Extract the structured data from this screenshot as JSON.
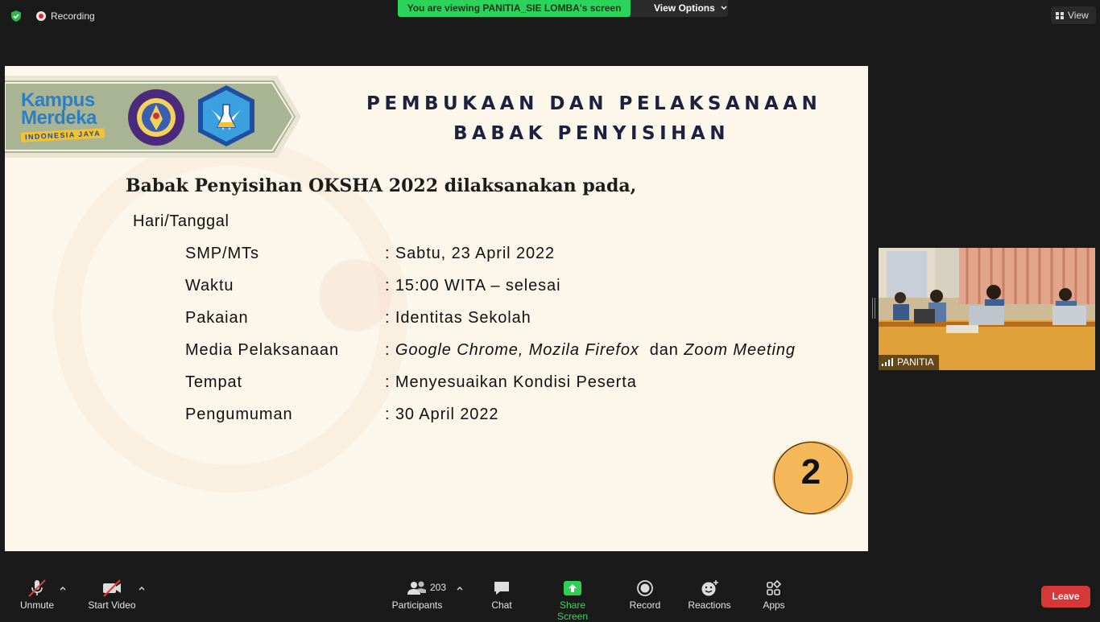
{
  "top_bar": {
    "recording_label": "Recording",
    "viewing_text": "You are viewing PANITIA_SIE LOMBA's screen",
    "view_options_label": "View Options",
    "view_label": "View"
  },
  "slide": {
    "logo_line1": "Kampus",
    "logo_line2": "Merdeka",
    "logo_line3": "INDONESIA JAYA",
    "title_line1": "PEMBUKAAN DAN PELAKSANAAN",
    "title_line2": "BABAK PENYISIHAN",
    "lead": "Babak Penyisihan OKSHA 2022 dilaksanakan pada,",
    "hari_label": "Hari/Tanggal",
    "rows": [
      {
        "label": "SMP/MTs",
        "value": ": Sabtu, 23 April 2022"
      },
      {
        "label": "Waktu",
        "value": ": 15:00 WITA – selesai"
      },
      {
        "label": "Pakaian",
        "value": ": Identitas Sekolah"
      },
      {
        "label": "Media Pelaksanaan",
        "value_prefix": ": ",
        "value_italic1": "Google Chrome, Mozila Firefox",
        "value_mid": "  dan ",
        "value_italic2": "Zoom Meeting"
      },
      {
        "label": "Tempat",
        "value": ": Menyesuaikan Kondisi Peserta"
      },
      {
        "label": "Pengumuman",
        "value": ": 30 April 2022"
      }
    ],
    "page_number": "2"
  },
  "video": {
    "participant_name": "PANITIA"
  },
  "toolbar": {
    "unmute": "Unmute",
    "start_video": "Start Video",
    "participants": "Participants",
    "participants_count": "203",
    "chat": "Chat",
    "share_screen": "Share Screen",
    "record": "Record",
    "reactions": "Reactions",
    "apps": "Apps",
    "leave": "Leave"
  },
  "colors": {
    "viewing_banner": "#2bd35a",
    "share_screen": "#39d561",
    "leave": "#d63838",
    "slide_bg": "#fdf6ea",
    "title": "#1b2240",
    "badge": "#f4b75a"
  }
}
